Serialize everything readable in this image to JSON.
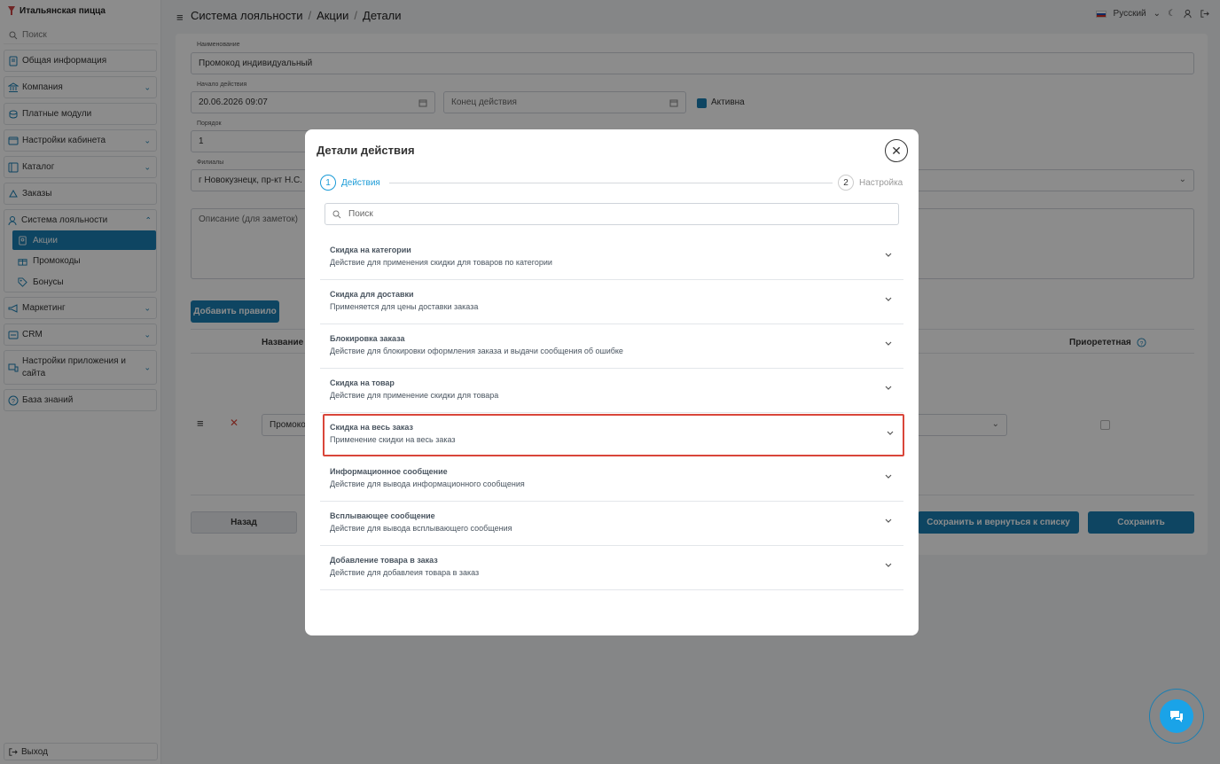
{
  "sidebar": {
    "brand": "Итальянская пицца",
    "search_placeholder": "Поиск",
    "items": [
      {
        "label": "Общая информация"
      },
      {
        "label": "Компания"
      },
      {
        "label": "Платные модули"
      },
      {
        "label": "Настройки кабинета"
      },
      {
        "label": "Каталог"
      },
      {
        "label": "Заказы"
      },
      {
        "label": "Система лояльности"
      },
      {
        "label": "Маркетинг"
      },
      {
        "label": "CRM"
      },
      {
        "label": "Настройки приложения и сайта"
      },
      {
        "label": "База знаний"
      }
    ],
    "loyalty_sub": [
      {
        "label": "Акции"
      },
      {
        "label": "Промокоды"
      },
      {
        "label": "Бонусы"
      }
    ],
    "logout": "Выход"
  },
  "header": {
    "breadcrumb": [
      "Система лояльности",
      "/",
      "Акции",
      "/",
      "Детали"
    ],
    "language": "Русский"
  },
  "form": {
    "name_label": "Наименование",
    "name_value": "Промокод индивидуальный",
    "start_label": "Начало действия",
    "start_value": "20.06.2026 09:07",
    "end_placeholder": "Конец действия",
    "active_label": "Активна",
    "order_label": "Порядок",
    "order_value": "1",
    "branches_label": "Филиалы",
    "branches_value": "г Новокузнецк, пр-кт Н.С.",
    "description_placeholder": "Описание (для заметок)",
    "add_rule_button": "Добавить правило",
    "col_name": "Название п",
    "col_priority": "Приорететная",
    "row_value": "Промоко",
    "back_button": "Назад",
    "save_return_button": "Сохранить и вернуться к списку",
    "save_button": "Сохранить"
  },
  "modal": {
    "title": "Детали действия",
    "steps": [
      {
        "num": "1",
        "label": "Действия"
      },
      {
        "num": "2",
        "label": "Настройка"
      }
    ],
    "search_placeholder": "Поиск",
    "actions": [
      {
        "title": "Скидка на категории",
        "desc": "Действие для применения скидки для товаров по категории"
      },
      {
        "title": "Скидка для доставки",
        "desc": "Применяется для цены доставки заказа"
      },
      {
        "title": "Блокировка заказа",
        "desc": "Действие для блокировки оформления заказа и выдачи сообщения об ошибке"
      },
      {
        "title": "Скидка на товар",
        "desc": "Действие для применение скидки для товара"
      },
      {
        "title": "Скидка на весь заказ",
        "desc": "Применение скидки на весь заказ"
      },
      {
        "title": "Информационное сообщение",
        "desc": "Действие для вывода информационного сообщения"
      },
      {
        "title": "Всплывающее сообщение",
        "desc": "Действие для вывода всплывающего сообщения"
      },
      {
        "title": "Добавление товара в заказ",
        "desc": "Действие для добавлеия товара в заказ"
      }
    ]
  },
  "colors": {
    "accent": "#1a7fb3",
    "highlight_border": "#d9463a"
  }
}
